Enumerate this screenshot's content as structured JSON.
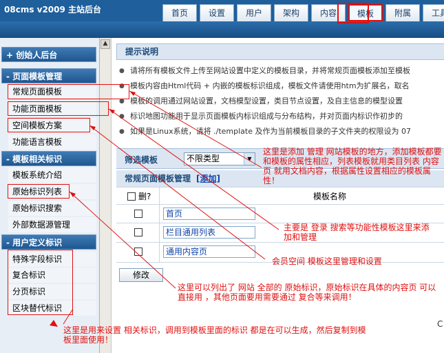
{
  "header": {
    "brand": "08cms  v2009  主站后台",
    "tabs": [
      "首页",
      "设置",
      "用户",
      "架构",
      "内容",
      "模板",
      "附属",
      "工具"
    ],
    "active_tab": "模板"
  },
  "sidebar": {
    "groups": [
      {
        "label": "+  创始人后台"
      },
      {
        "label": "-  页面模板管理"
      },
      {
        "label": "-  模板相关标识"
      },
      {
        "label": "-  用户定义标识"
      }
    ],
    "items": [
      "常规页面模板",
      "功能页面模板",
      "空间模板方案",
      "功能语言模板",
      "模板系统介绍",
      "原始标识列表",
      "原始标识搜索",
      "外部数据源管理",
      "特殊字段标识",
      "复合标识",
      "分页标识",
      "区块替代标识"
    ]
  },
  "scrollbar": {
    "up_glyph": "▲"
  },
  "tips": {
    "title": "提示说明",
    "lines": [
      "请将所有模板文件上传至网站设置中定义的模板目录，并将常规页面模板添加至模板",
      "模板内容由Html代码 + 内嵌的模板标识组成，模板文件请使用htm为扩展名，取名",
      "模板的调用通过网站设置，文档模型设置，类目节点设置，及自主信息的模型设置",
      "标识地图功能用于显示页面模板内标识组成与分布结构，并对页面内标识作初步的",
      "如果是Linux系统，请将  ./template 及作为当前模板目录的子文件夹的权限设为 07"
    ]
  },
  "filter": {
    "label": "筛选模板",
    "select_value": "不限类型",
    "arrow": "▼"
  },
  "list": {
    "title": "常规页面模板管理",
    "add_label": "[添加]",
    "col_check": "删?",
    "col_name": "模板名称",
    "rows": [
      "首页",
      "栏目通用列表",
      "通用内容页"
    ],
    "modify_label": "修改"
  },
  "annotations": {
    "a1": "这里是添加  管理  网站模板的地方，添加模板都要和模板的属性相应，列表模板就用类目列表  内容页  就用文档内容，根据属性设置相应的模板属性！",
    "a2": "主要是  登录  搜索等功能性模板这里来添加和管理",
    "a3": "会员空间  模板这里管理和设置",
    "a4": "这里可以列出了  网站  全部的  原始标识，原始标识在具体的内容页  可以直接用  ，其他页面要用需要通过  复合等来调用！",
    "a5": "这里是用来设置  相关标识，调用到模板里面的标识  都是在可以生成，然后复制到模板里面使用！",
    "stray": "C"
  }
}
